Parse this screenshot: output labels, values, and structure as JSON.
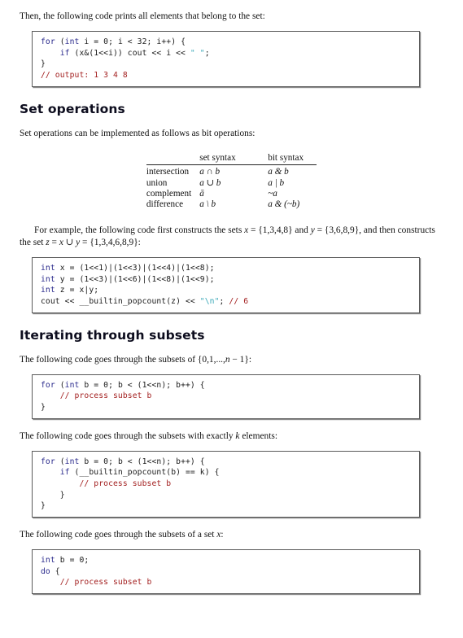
{
  "document": {
    "intro_paragraph": "Then, the following code prints all elements that belong to the set:",
    "code_print_elements": {
      "lines": [
        [
          {
            "t": "for ",
            "c": "kw"
          },
          {
            "t": "(",
            "c": "pl"
          },
          {
            "t": "int",
            "c": "kw"
          },
          {
            "t": " i = 0; i < 32; i++) {",
            "c": "pl"
          }
        ],
        [
          {
            "t": "    ",
            "c": "pl"
          },
          {
            "t": "if",
            "c": "kw"
          },
          {
            "t": " (x&(1<<i)) cout << i << ",
            "c": "pl"
          },
          {
            "t": "\" \"",
            "c": "str"
          },
          {
            "t": ";",
            "c": "pl"
          }
        ],
        [
          {
            "t": "}",
            "c": "pl"
          }
        ],
        [
          {
            "t": "// output: 1 3 4 8",
            "c": "cm"
          }
        ]
      ]
    },
    "section_set_operations": {
      "heading": "Set operations",
      "paragraph": "Set operations can be implemented as follows as bit operations:",
      "table": {
        "columns": [
          "",
          "set syntax",
          "bit syntax"
        ],
        "rows": [
          {
            "name": "intersection",
            "set_syntax": "a ∩ b",
            "bit_syntax": "a & b"
          },
          {
            "name": "union",
            "set_syntax": "a ∪ b",
            "bit_syntax": "a | b"
          },
          {
            "name": "complement",
            "set_syntax": "ā",
            "bit_syntax": "~a"
          },
          {
            "name": "difference",
            "set_syntax": "a \\ b",
            "bit_syntax": "a & (~b)"
          }
        ]
      },
      "example_paragraph_parts": {
        "p1": "For example, the following code first constructs the sets ",
        "x": "x",
        "p2": " = {1,3,4,8} and ",
        "y": "y",
        "p3": " = {3,6,8,9}, and then constructs the set ",
        "z": "z",
        "p4": " = ",
        "x2": "x",
        "p5": " ∪ ",
        "y2": "y",
        "p6": " = {1,3,4,6,8,9}:"
      },
      "code_construct_sets": {
        "lines": [
          [
            {
              "t": "int",
              "c": "kw"
            },
            {
              "t": " x = (1<<1)|(1<<3)|(1<<4)|(1<<8);",
              "c": "pl"
            }
          ],
          [
            {
              "t": "int",
              "c": "kw"
            },
            {
              "t": " y = (1<<3)|(1<<6)|(1<<8)|(1<<9);",
              "c": "pl"
            }
          ],
          [
            {
              "t": "int",
              "c": "kw"
            },
            {
              "t": " z = x|y;",
              "c": "pl"
            }
          ],
          [
            {
              "t": "cout << __builtin_popcount(z) << ",
              "c": "pl"
            },
            {
              "t": "\"\\n\"",
              "c": "str"
            },
            {
              "t": "; ",
              "c": "pl"
            },
            {
              "t": "// 6",
              "c": "cm"
            }
          ]
        ]
      }
    },
    "section_iterating": {
      "heading": "Iterating through subsets",
      "paragraph_1_parts": {
        "p1": "The following code goes through the subsets of {0,1,...,",
        "n": "n",
        "p2": " − 1}:"
      },
      "code_all_subsets": {
        "lines": [
          [
            {
              "t": "for ",
              "c": "kw"
            },
            {
              "t": "(",
              "c": "pl"
            },
            {
              "t": "int",
              "c": "kw"
            },
            {
              "t": " b = 0; b < (1<<n); b++) {",
              "c": "pl"
            }
          ],
          [
            {
              "t": "    ",
              "c": "pl"
            },
            {
              "t": "// process subset b",
              "c": "cm"
            }
          ],
          [
            {
              "t": "}",
              "c": "pl"
            }
          ]
        ]
      },
      "paragraph_2_parts": {
        "p1": "The following code goes through the subsets with exactly ",
        "k": "k",
        "p2": " elements:"
      },
      "code_k_subsets": {
        "lines": [
          [
            {
              "t": "for ",
              "c": "kw"
            },
            {
              "t": "(",
              "c": "pl"
            },
            {
              "t": "int",
              "c": "kw"
            },
            {
              "t": " b = 0; b < (1<<n); b++) {",
              "c": "pl"
            }
          ],
          [
            {
              "t": "    ",
              "c": "pl"
            },
            {
              "t": "if",
              "c": "kw"
            },
            {
              "t": " (__builtin_popcount(b) == k) {",
              "c": "pl"
            }
          ],
          [
            {
              "t": "        ",
              "c": "pl"
            },
            {
              "t": "// process subset b",
              "c": "cm"
            }
          ],
          [
            {
              "t": "    }",
              "c": "pl"
            }
          ],
          [
            {
              "t": "}",
              "c": "pl"
            }
          ]
        ]
      },
      "paragraph_3_parts": {
        "p1": "The following code goes through the subsets of a set ",
        "x": "x",
        "p2": ":"
      },
      "code_subsets_of_x": {
        "lines": [
          [
            {
              "t": "int",
              "c": "kw"
            },
            {
              "t": " b = 0;",
              "c": "pl"
            }
          ],
          [
            {
              "t": "do",
              "c": "kw"
            },
            {
              "t": " {",
              "c": "pl"
            }
          ],
          [
            {
              "t": "    ",
              "c": "pl"
            },
            {
              "t": "// process subset b",
              "c": "cm"
            }
          ]
        ]
      }
    }
  },
  "colors": {
    "keyword": "#2a2a8c",
    "comment": "#a32020",
    "string": "#3aa8b8",
    "plain": "#1a1a1a",
    "border": "#5a5a5a",
    "heading": "#0d0d1e"
  }
}
